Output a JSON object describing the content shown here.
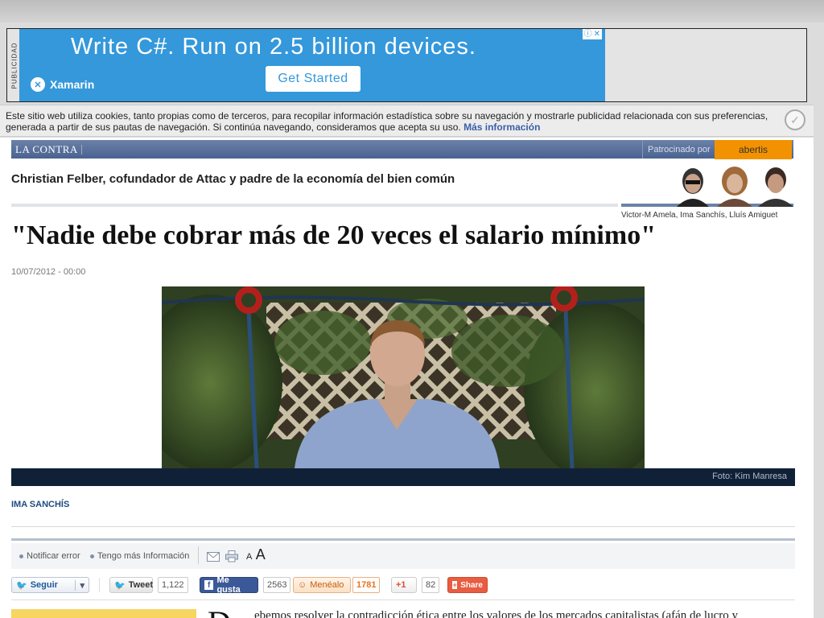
{
  "ad": {
    "side_label": "PUBLICIDAD",
    "headline": "Write C#. Run on 2.5 billion devices.",
    "brand": "Xamarin",
    "cta": "Get Started"
  },
  "cookie_notice": {
    "text": "Este sitio web utiliza cookies, tanto propias como de terceros, para recopilar información estadística sobre su navegación y mostrarle publicidad relacionada con sus preferencias, generada a partir de sus pautas de navegación. Si continúa navegando, consideramos que acepta su uso.",
    "link": "Más información"
  },
  "section": {
    "name": "LA CONTRA",
    "sponsored_label": "Patrocinado por",
    "sponsor": "abertis",
    "title": "Christian Felber, cofundador de Attac y padre de la economía del bien común",
    "authors": "Victor-M Amela, Ima Sanchís, Lluís Amiguet"
  },
  "article": {
    "headline": "\"Nadie debe cobrar más de 20 veces el salario mínimo\"",
    "date": "10/07/2012 - 00:00",
    "photo_credit": "Foto: Kim Manresa",
    "byline": "IMA SANCHÍS",
    "dropcap": "D",
    "first_line": "ebemos resolver la contradicción ética entre los valores de los mercados capitalistas (afán de lucro y"
  },
  "tools": {
    "report_error": "Notificar error",
    "more_info": "Tengo más Información",
    "font_small": "A",
    "font_large": "A"
  },
  "social": {
    "follow": "Seguir",
    "tweet": "Tweet",
    "tweet_count": "1,122",
    "like": "Me gusta",
    "like_count": "2563",
    "meneame": "Menéalo",
    "meneame_count": "1781",
    "gplus": "+1",
    "gplus_count": "82",
    "share": "Share"
  },
  "colors": {
    "ad_blue": "#3498db",
    "section_blue": "#4a6290",
    "sponsor_orange": "#f39200",
    "caption_bar": "#102137",
    "facebook": "#3b5998",
    "meneame": "#e8731c",
    "gplus": "#dd4b39"
  }
}
